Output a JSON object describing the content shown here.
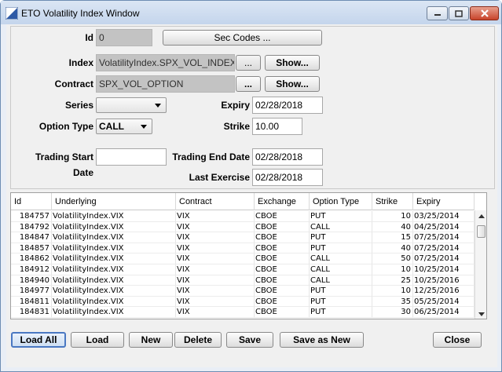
{
  "window": {
    "title": "ETO Volatility Index Window",
    "title_icon": "app-logo-icon"
  },
  "form": {
    "id_label": "Id",
    "id_value": "0",
    "sec_codes_label": "Sec Codes ...",
    "index_label": "Index",
    "index_value": "VolatilityIndex.SPX_VOL_INDEX",
    "contract_label": "Contract",
    "contract_value": "SPX_VOL_OPTION",
    "browse_label": "...",
    "show_label": "Show...",
    "series_label": "Series",
    "series_value": "",
    "expiry_label": "Expiry",
    "expiry_value": "02/28/2018",
    "option_type_label": "Option Type",
    "option_type_value": "CALL",
    "strike_label": "Strike",
    "strike_value": "10.00",
    "trading_start_label": "Trading Start Date",
    "trading_start_value": "",
    "trading_end_label": "Trading End Date",
    "trading_end_value": "02/28/2018",
    "last_exercise_label": "Last Exercise",
    "last_exercise_value": "02/28/2018"
  },
  "table": {
    "columns": [
      "Id",
      "Underlying",
      "Contract",
      "Exchange",
      "Option Type",
      "Strike",
      "Expiry"
    ],
    "rows": [
      [
        "184757",
        "VolatilityIndex.VIX",
        "VIX",
        "CBOE",
        "PUT",
        "10",
        "03/25/2014"
      ],
      [
        "184792",
        "VolatilityIndex.VIX",
        "VIX",
        "CBOE",
        "CALL",
        "40",
        "04/25/2014"
      ],
      [
        "184847",
        "VolatilityIndex.VIX",
        "VIX",
        "CBOE",
        "PUT",
        "15",
        "07/25/2014"
      ],
      [
        "184857",
        "VolatilityIndex.VIX",
        "VIX",
        "CBOE",
        "PUT",
        "40",
        "07/25/2014"
      ],
      [
        "184862",
        "VolatilityIndex.VIX",
        "VIX",
        "CBOE",
        "CALL",
        "50",
        "07/25/2014"
      ],
      [
        "184912",
        "VolatilityIndex.VIX",
        "VIX",
        "CBOE",
        "CALL",
        "10",
        "10/25/2014"
      ],
      [
        "184940",
        "VolatilityIndex.VIX",
        "VIX",
        "CBOE",
        "CALL",
        "25",
        "10/25/2016"
      ],
      [
        "184977",
        "VolatilityIndex.VIX",
        "VIX",
        "CBOE",
        "PUT",
        "10",
        "12/25/2016"
      ],
      [
        "184811",
        "VolatilityIndex.VIX",
        "VIX",
        "CBOE",
        "PUT",
        "35",
        "05/25/2014"
      ],
      [
        "184831",
        "VolatilityIndex.VIX",
        "VIX",
        "CBOE",
        "PUT",
        "30",
        "06/25/2014"
      ]
    ]
  },
  "buttons": {
    "load_all": "Load All",
    "load": "Load",
    "new": "New",
    "delete": "Delete",
    "save": "Save",
    "save_as_new": "Save as New",
    "close": "Close"
  }
}
